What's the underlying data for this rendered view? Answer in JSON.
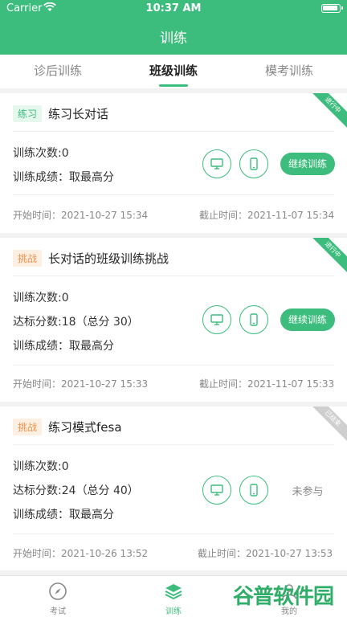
{
  "status_bar": {
    "carrier": "Carrier",
    "time": "10:37 AM"
  },
  "header": {
    "title": "训练"
  },
  "tabs": [
    {
      "label": "诊后训练",
      "active": false
    },
    {
      "label": "班级训练",
      "active": true
    },
    {
      "label": "模考训练",
      "active": false
    }
  ],
  "cards": [
    {
      "tag": "练习",
      "title": "练习长对话",
      "corner": "进行中",
      "lines": [
        "训练次数:0",
        "训练成绩：取最高分"
      ],
      "action": "继续训练",
      "start": "开始时间：2021-10-27 15:34",
      "end": "截止时间：2021-11-07 15:34"
    },
    {
      "tag": "挑战",
      "title": "长对话的班级训练挑战",
      "corner": "进行中",
      "lines": [
        "训练次数:0",
        "达标分数:18（总分 30）",
        "训练成绩：取最高分"
      ],
      "action": "继续训练",
      "start": "开始时间：2021-10-27 15:33",
      "end": "截止时间：2021-11-07 15:33"
    },
    {
      "tag": "挑战",
      "title": "练习模式fesa",
      "corner": "已结束",
      "lines": [
        "训练次数:0",
        "达标分数:24（总分 40）",
        "训练成绩：取最高分"
      ],
      "action": "未参与",
      "start": "开始时间：2021-10-26 13:52",
      "end": "截止时间：2021-10-27 13:53"
    }
  ],
  "bottom_nav": [
    {
      "label": "考试",
      "icon": "compass-icon"
    },
    {
      "label": "训练",
      "icon": "layers-icon"
    },
    {
      "label": "我的",
      "icon": "profile-icon"
    }
  ],
  "watermark": "谷普软件园",
  "colors": {
    "brand": "#3dbd7d",
    "challenge_tag": "#f0944c"
  }
}
